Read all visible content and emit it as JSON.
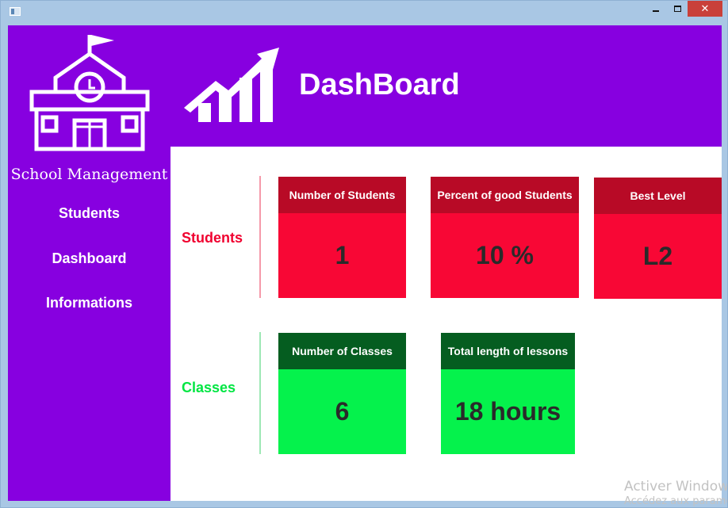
{
  "window": {
    "icons": {
      "app": "app-window-icon",
      "minimize": "minimize-icon",
      "maximize": "maximize-icon",
      "close": "close-icon"
    },
    "close_glyph": "✕"
  },
  "sidebar": {
    "logo_icon": "school-building-icon",
    "brand": "School Management",
    "items": [
      {
        "label": "Students"
      },
      {
        "label": "Dashboard"
      },
      {
        "label": "Informations"
      }
    ]
  },
  "header": {
    "icon": "growth-chart-icon",
    "title": "DashBoard"
  },
  "sections": {
    "students": {
      "label": "Students",
      "cards": [
        {
          "title": "Number of Students",
          "value": "1"
        },
        {
          "title": "Percent of good Students",
          "value": "10 %"
        },
        {
          "title": "Best Level",
          "value": "L2"
        }
      ]
    },
    "classes": {
      "label": "Classes",
      "cards": [
        {
          "title": "Number of Classes",
          "value": "6"
        },
        {
          "title": "Total length of lessons",
          "value": "18 hours"
        }
      ]
    }
  },
  "watermark": {
    "line1": "Activer Windows",
    "line2": "Accédez aux paramètres"
  },
  "colors": {
    "primary": "#8700e0",
    "students_accent": "#f0002f",
    "students_card_head": "#b80a26",
    "students_card_body": "#f80735",
    "classes_accent": "#00e642",
    "classes_card_head": "#055d20",
    "classes_card_body": "#05f24c"
  }
}
